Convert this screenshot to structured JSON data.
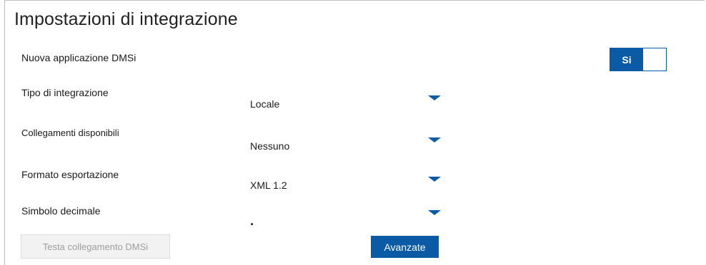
{
  "page": {
    "title": "Impostazioni di integrazione"
  },
  "fields": {
    "new_app": {
      "label": "Nuova applicazione DMSi",
      "toggle_label": "Si",
      "state": "on"
    },
    "integration_type": {
      "label": "Tipo di integrazione",
      "value": "Locale"
    },
    "available_links": {
      "label": "Collegamenti disponibili",
      "value": "Nessuno"
    },
    "export_format": {
      "label": "Formato esportazione",
      "value": "XML 1.2"
    },
    "decimal_symbol": {
      "label": "Simbolo decimale",
      "value": "."
    }
  },
  "buttons": {
    "test_connection": {
      "label": "Testa collegamento DMSi",
      "enabled": false
    },
    "advanced": {
      "label": "Avanzate",
      "enabled": true
    }
  },
  "colors": {
    "accent": "#0b5aa6",
    "disabled_bg": "#f2f2f2",
    "disabled_text": "#9e9e9e"
  },
  "icons": {
    "dropdown": "chevron-down-icon"
  }
}
